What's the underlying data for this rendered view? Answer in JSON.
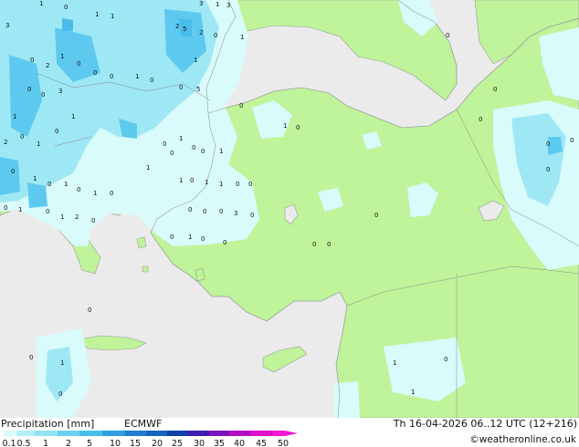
{
  "header": {
    "title": "Precipitation [mm]",
    "model": "ECMWF",
    "valid_time": "Th 16-04-2026 06..12 UTC (12+216)",
    "credit": "©weatheronline.co.uk"
  },
  "legend": {
    "tick_labels": [
      "0.1",
      "0.5",
      "1",
      "2",
      "5",
      "10",
      "15",
      "20",
      "25",
      "30",
      "35",
      "40",
      "45",
      "50"
    ],
    "colors": [
      "#d9fbfb",
      "#b5f0f6",
      "#8fe3f2",
      "#69d1ef",
      "#49bde9",
      "#2d9fe0",
      "#1e7fd1",
      "#1563c2",
      "#0c41a8",
      "#3e1eb2",
      "#7a12bd",
      "#b40dc6",
      "#e00dcc",
      "#f218d6"
    ]
  },
  "map_colors": {
    "sea": "#ebebeb",
    "land": "#bff49a",
    "light_rain": "#d9fbfb",
    "rain": "#9ee8f5",
    "heavy_rain": "#5ec9ef",
    "coast": "#9a9a9a"
  },
  "map_labels": [
    "3",
    "1",
    "0",
    "1",
    "1",
    "2",
    "2",
    "3",
    "1",
    "3",
    "5",
    "0",
    "1",
    "0",
    "2",
    "1",
    "0",
    "0",
    "0",
    "1",
    "0",
    "1",
    "0",
    "5",
    "0",
    "0",
    "3",
    "1",
    "0",
    "1",
    "0",
    "1",
    "2",
    "0",
    "1",
    "0",
    "1",
    "0",
    "1",
    "0",
    "0",
    "1",
    "0",
    "1",
    "2",
    "0",
    "1",
    "0",
    "1",
    "0",
    "0",
    "0",
    "1",
    "1",
    "0",
    "1",
    "1",
    "0",
    "0",
    "0",
    "0",
    "0",
    "3",
    "0",
    "0",
    "1",
    "0",
    "0",
    "0",
    "1",
    "0",
    "0",
    "0",
    "0",
    "0",
    "0",
    "0",
    "0",
    "0",
    "0",
    "1",
    "0",
    "1",
    "1",
    "0",
    "0",
    "0"
  ]
}
